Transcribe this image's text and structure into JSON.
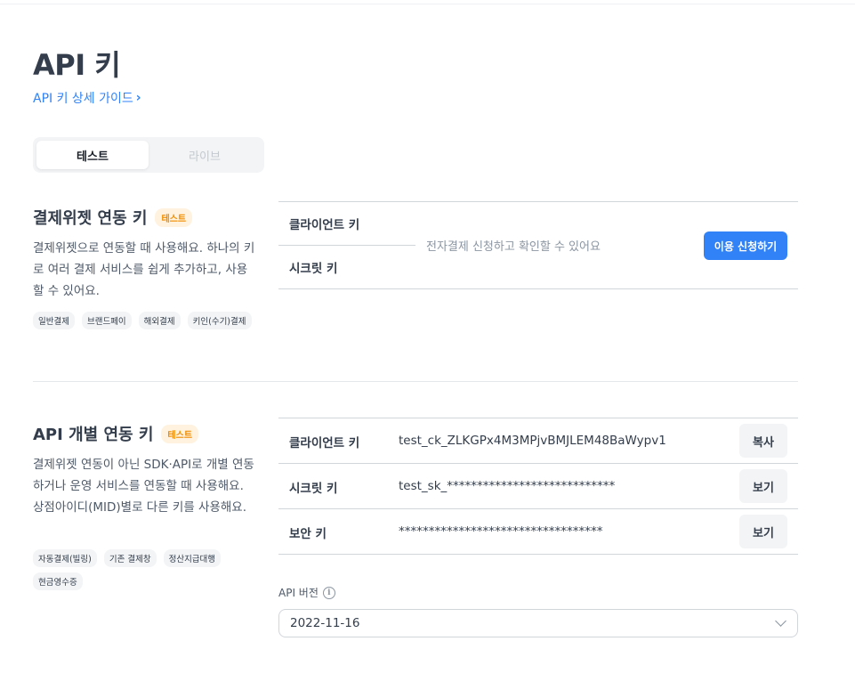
{
  "header": {
    "title": "API 키",
    "guide_link": "API 키 상세 가이드",
    "guide_chevron": "›"
  },
  "mode_toggle": {
    "options": [
      "테스트",
      "라이브"
    ],
    "selected": "테스트"
  },
  "widget_section": {
    "title": "결제위젯 연동 키",
    "badge": "테스트",
    "description": "결제위젯으로 연동할 때 사용해요. 하나의 키로 여러 결제 서비스를 쉽게 추가하고, 사용할 수 있어요.",
    "tags": [
      "일반결제",
      "브랜드페이",
      "해외결제",
      "키인(수기)결제"
    ],
    "client_key_label": "클라이언트 키",
    "secret_key_label": "시크릿 키",
    "message": "전자결제 신청하고 확인할 수 있어요",
    "apply_button": "이용 신청하기"
  },
  "api_section": {
    "title": "API 개별 연동 키",
    "badge": "테스트",
    "description": "결제위젯 연동이 아닌 SDK·API로 개별 연동하거나 운영 서비스를 연동할 때 사용해요. 상점아이디(MID)별로 다른 키를 사용해요.",
    "tags": [
      "자동결제(빌링)",
      "기존 결제창",
      "정산지급대행",
      "현금영수증"
    ],
    "rows": [
      {
        "label": "클라이언트 키",
        "value": "test_ck_ZLKGPx4M3MPjvBMJLEM48BaWypv1",
        "button": "복사"
      },
      {
        "label": "시크릿 키",
        "value": "test_sk_****************************",
        "button": "보기"
      },
      {
        "label": "보안 키",
        "value": "**********************************",
        "button": "보기"
      }
    ],
    "version_label": "API 버전",
    "version_value": "2022-11-16"
  },
  "icons": {
    "info": "info-icon",
    "guide_chevron": "chevron-right-icon",
    "select_chevron": "chevron-down-icon"
  },
  "colors": {
    "accent": "#3182f6",
    "badge_text": "#f08c00",
    "badge_bg": "#fff3e0",
    "text_primary": "#333d4b"
  }
}
